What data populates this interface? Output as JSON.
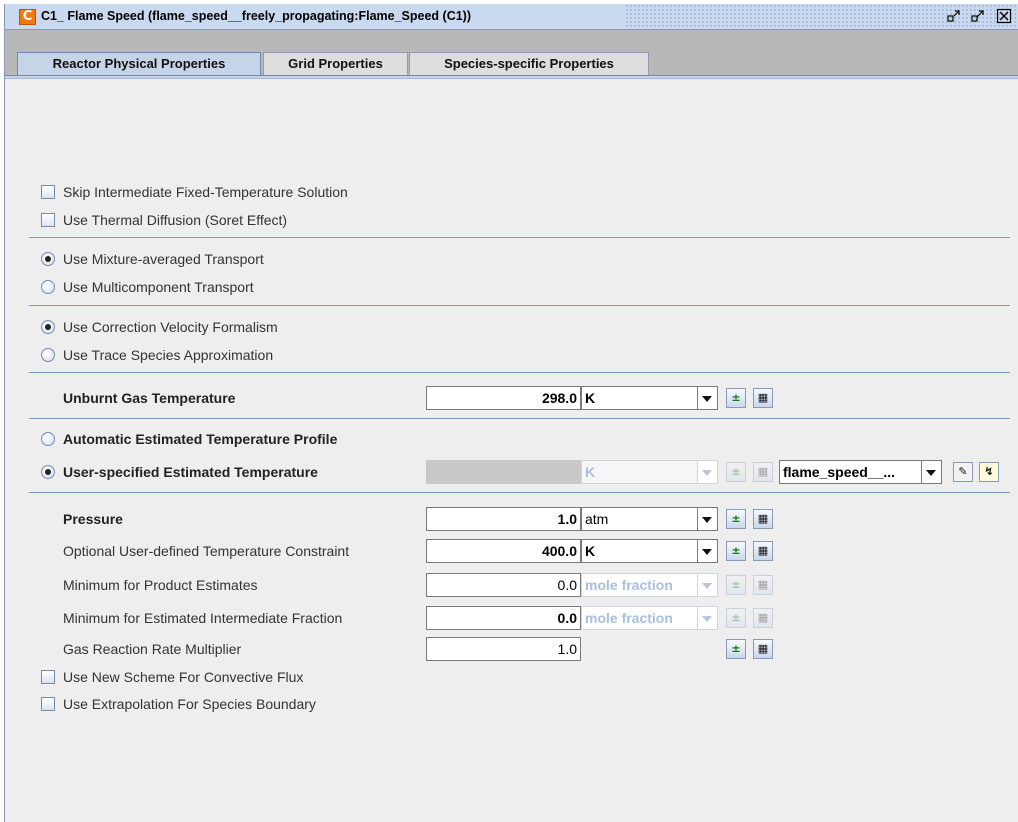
{
  "window": {
    "logo": "C",
    "title": "C1_ Flame Speed  (flame_speed__freely_propagating:Flame_Speed (C1))",
    "minimize_icon": "minimize-icon",
    "maximize_icon": "maximize-icon",
    "close_icon": "close-icon"
  },
  "tabs": [
    {
      "label": "Reactor Physical Properties",
      "active": true
    },
    {
      "label": "Grid Properties",
      "active": false
    },
    {
      "label": "Species-specific Properties",
      "active": false
    }
  ],
  "options": {
    "skip_intermediate": "Skip Intermediate Fixed-Temperature Solution",
    "thermal_diffusion": "Use Thermal Diffusion (Soret Effect)",
    "mixture_transport": "Use Mixture-averaged Transport",
    "multicomponent_transport": "Use Multicomponent Transport",
    "correction_velocity": "Use Correction Velocity Formalism",
    "trace_species": "Use Trace Species Approximation",
    "auto_temp_profile": "Automatic Estimated Temperature Profile",
    "user_temp_profile": "User-specified Estimated Temperature",
    "new_scheme": "Use New Scheme For Convective Flux",
    "extrapolation": "Use Extrapolation For Species Boundary"
  },
  "fields": {
    "unburnt_temp": {
      "label": "Unburnt Gas Temperature",
      "value": "298.0",
      "unit": "K"
    },
    "user_temp": {
      "unit": "K",
      "profile": "flame_speed__..."
    },
    "pressure": {
      "label": "Pressure",
      "value": "1.0",
      "unit": "atm"
    },
    "temp_constraint": {
      "label": "Optional User-defined Temperature Constraint",
      "value": "400.0",
      "unit": "K"
    },
    "min_product": {
      "label": "Minimum for Product Estimates",
      "value": "0.0",
      "unit": "mole fraction"
    },
    "min_intermediate": {
      "label": "Minimum for Estimated Intermediate Fraction",
      "value": "0.0",
      "unit": "mole fraction"
    },
    "rate_multiplier": {
      "label": "Gas Reaction Rate Multiplier",
      "value": "1.0"
    }
  },
  "icons": {
    "add_remove": "add-remove-icon",
    "parameter_study": "parameter-study-icon",
    "edit": "pencil-icon",
    "profile": "profile-chart-icon"
  }
}
